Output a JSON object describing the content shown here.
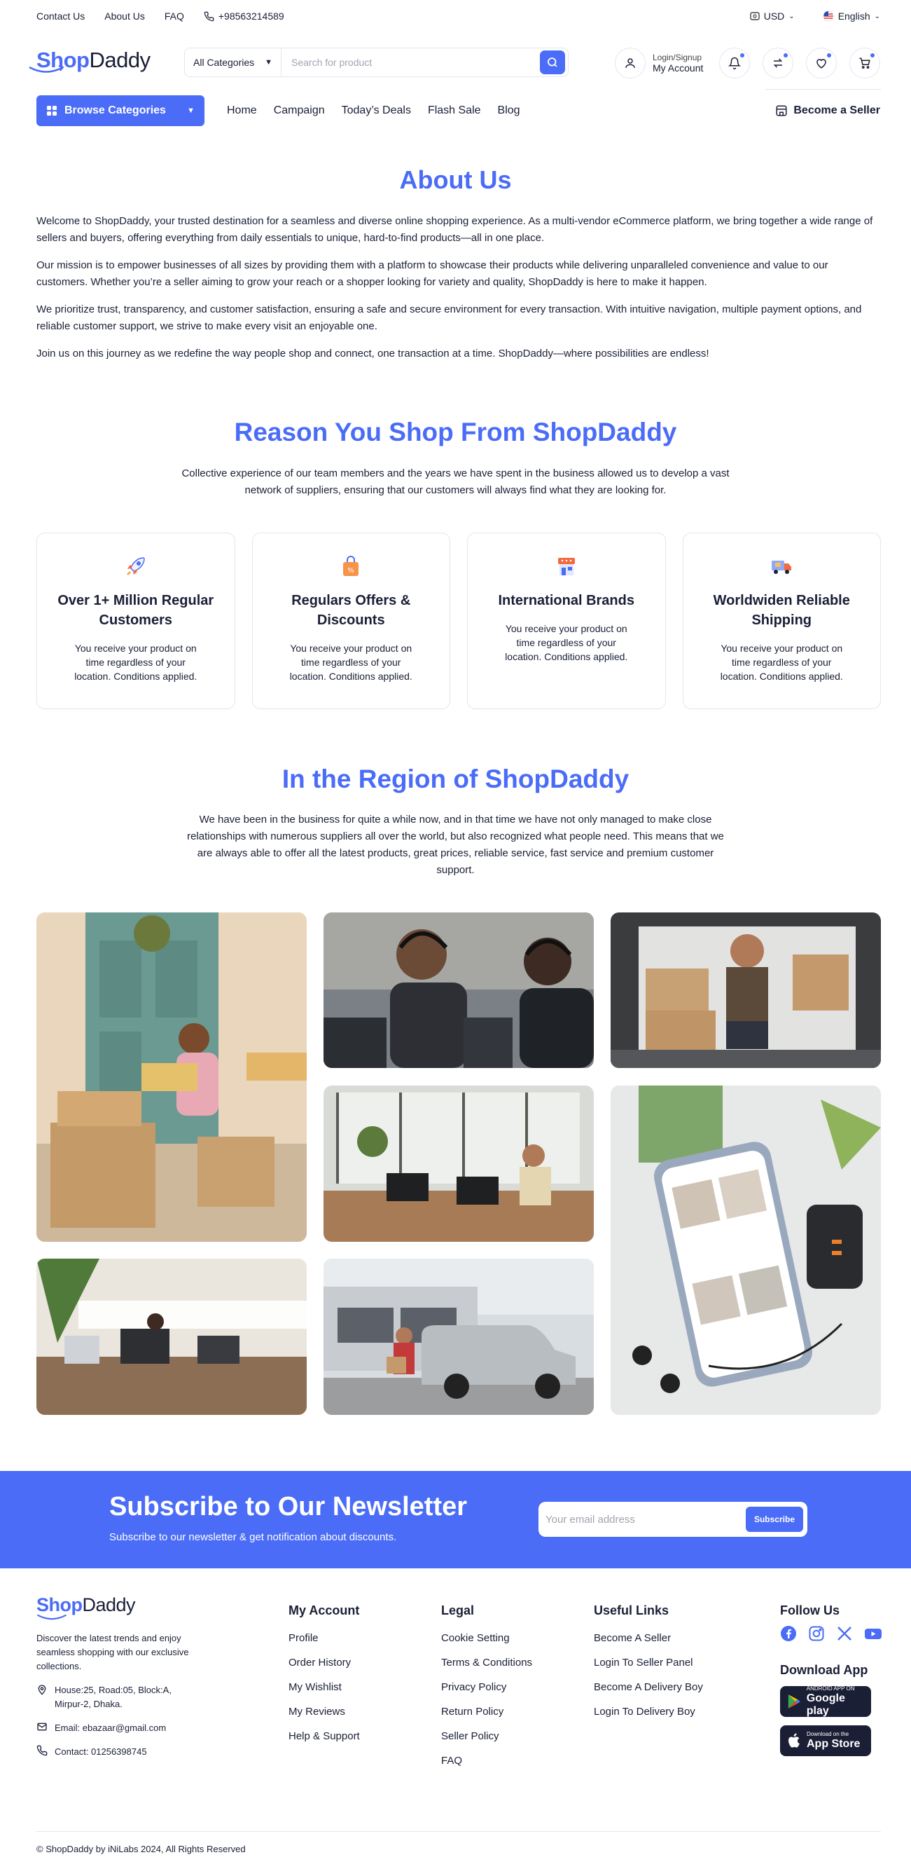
{
  "topbar": {
    "links": [
      "Contact Us",
      "About Us",
      "FAQ"
    ],
    "phone": "+98563214589",
    "currency": "USD",
    "language": "English"
  },
  "header": {
    "logo_shop": "Shop",
    "logo_daddy": "Daddy",
    "category": "All Categories",
    "search_placeholder": "Search for product",
    "login_top": "Login/Signup",
    "login_bottom": "My Account"
  },
  "nav": {
    "browse": "Browse Categories",
    "links": [
      "Home",
      "Campaign",
      "Today’s Deals",
      "Flash Sale",
      "Blog"
    ],
    "seller": "Become a Seller"
  },
  "about": {
    "title": "About Us",
    "paragraphs": [
      "Welcome to ShopDaddy, your trusted destination for a seamless and diverse online shopping experience. As a multi-vendor eCommerce platform, we bring together a wide range of sellers and buyers, offering everything from daily essentials to unique, hard-to-find products—all in one place.",
      "Our mission is to empower businesses of all sizes by providing them with a platform to showcase their products while delivering unparalleled convenience and value to our customers. Whether you’re a seller aiming to grow your reach or a shopper looking for variety and quality, ShopDaddy is here to make it happen.",
      "We prioritize trust, transparency, and customer satisfaction, ensuring a safe and secure environment for every transaction. With intuitive navigation, multiple payment options, and reliable customer support, we strive to make every visit an enjoyable one.",
      "Join us on this journey as we redefine the way people shop and connect, one transaction at a time. ShopDaddy—where possibilities are endless!"
    ]
  },
  "reason": {
    "title": "Reason You Shop From ShopDaddy",
    "subtitle": "Collective experience of our team members and the years we have spent in the business allowed us to develop a vast network of suppliers, ensuring that our customers will always find what they are looking for.",
    "cards": [
      {
        "title": "Over 1+ Million Regular Customers",
        "desc": "You receive your product on time regardless of your location. Conditions applied.",
        "icon": "rocket-icon"
      },
      {
        "title": "Regulars Offers & Discounts",
        "desc": "You receive your product on time regardless of your location. Conditions applied.",
        "icon": "shopping-bag-icon"
      },
      {
        "title": "International Brands",
        "desc": "You receive your product on time regardless of your location. Conditions applied.",
        "icon": "store-icon"
      },
      {
        "title": "Worldwiden Reliable Shipping",
        "desc": "You receive your product on time regardless of your location. Conditions applied.",
        "icon": "truck-icon"
      }
    ]
  },
  "region": {
    "title": "In the Region of ShopDaddy",
    "subtitle": "We have been in the business for quite a while now, and in that time we have not only managed to make close relationships with numerous suppliers all over the world, but also recognized what people need. This means that we are always able to offer all the latest products, great prices, reliable service, fast service and premium customer support."
  },
  "newsletter": {
    "title": "Subscribe to Our Newsletter",
    "subtitle": "Subscribe to our newsletter & get notification about discounts.",
    "placeholder": "Your email address",
    "button": "Subscribe"
  },
  "footer": {
    "desc": "Discover the latest trends and enjoy seamless shopping with our exclusive collections.",
    "address": "House:25, Road:05, Block:A, Mirpur-2, Dhaka.",
    "email": "Email: ebazaar@gmail.com",
    "contact": "Contact: 01256398745",
    "account": {
      "title": "My Account",
      "items": [
        "Profile",
        "Order History",
        "My Wishlist",
        "My Reviews",
        "Help & Support"
      ]
    },
    "legal": {
      "title": "Legal",
      "items": [
        "Cookie Setting",
        "Terms & Conditions",
        "Privacy Policy",
        "Return Policy",
        "Seller Policy",
        "FAQ"
      ]
    },
    "useful": {
      "title": "Useful Links",
      "items": [
        "Become A Seller",
        "Login To Seller Panel",
        "Become A Delivery Boy",
        "Login To Delivery Boy"
      ]
    },
    "follow": "Follow Us",
    "download": "Download App",
    "gp_small": "ANDROID APP ON",
    "gp_big": "Google play",
    "as_small": "Download on the",
    "as_big": "App Store",
    "copyright": "© ShopDaddy by iNiLabs 2024, All Rights Reserved"
  },
  "colors": {
    "accent": "#4a6cf7",
    "dark": "#1a1f36"
  }
}
